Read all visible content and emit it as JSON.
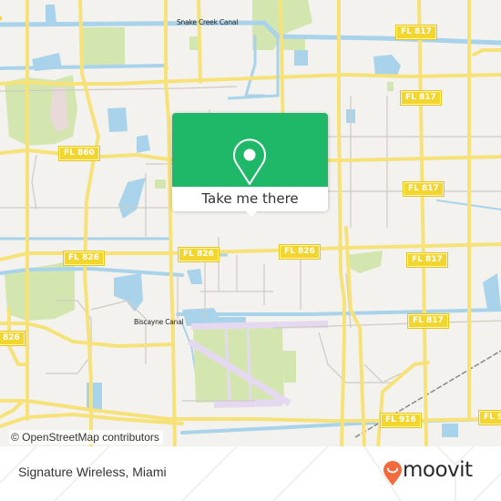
{
  "map": {
    "road_labels": [
      {
        "id": "fl-817-a",
        "text": "FL 817"
      },
      {
        "id": "fl-817-b",
        "text": "FL 817"
      },
      {
        "id": "fl-817-c",
        "text": "FL 817"
      },
      {
        "id": "fl-817-d",
        "text": "FL 817"
      },
      {
        "id": "fl-817-e",
        "text": "FL 817"
      },
      {
        "id": "fl-860",
        "text": "FL 860"
      },
      {
        "id": "fl-826-a",
        "text": "FL 826"
      },
      {
        "id": "fl-826-b",
        "text": "FL 826"
      },
      {
        "id": "fl-826-c",
        "text": "FL 826"
      },
      {
        "id": "fl-826-d",
        "text": "826"
      },
      {
        "id": "fl-916-a",
        "text": "FL 916"
      },
      {
        "id": "fl-916-b",
        "text": "FL 9"
      }
    ],
    "canal_labels": {
      "snake_creek": "Snake Creek Canal",
      "biscayne": "Biscayne Canal"
    },
    "attribution": "© OpenStreetMap contributors",
    "colors": {
      "land": "#f3f2ee",
      "water": "#a9d3ea",
      "park": "#cfe3a8",
      "road_major": "#f7e27a",
      "road_minor": "#cfccc4",
      "airport": "#e4d9f0",
      "shield": "#f3d530"
    }
  },
  "popup": {
    "button_label": "Take me there",
    "accent": "#1fb868"
  },
  "footer": {
    "place_name": "Signature Wireless, Miami",
    "brand": "moovit",
    "brand_color": "#f26a3d"
  }
}
